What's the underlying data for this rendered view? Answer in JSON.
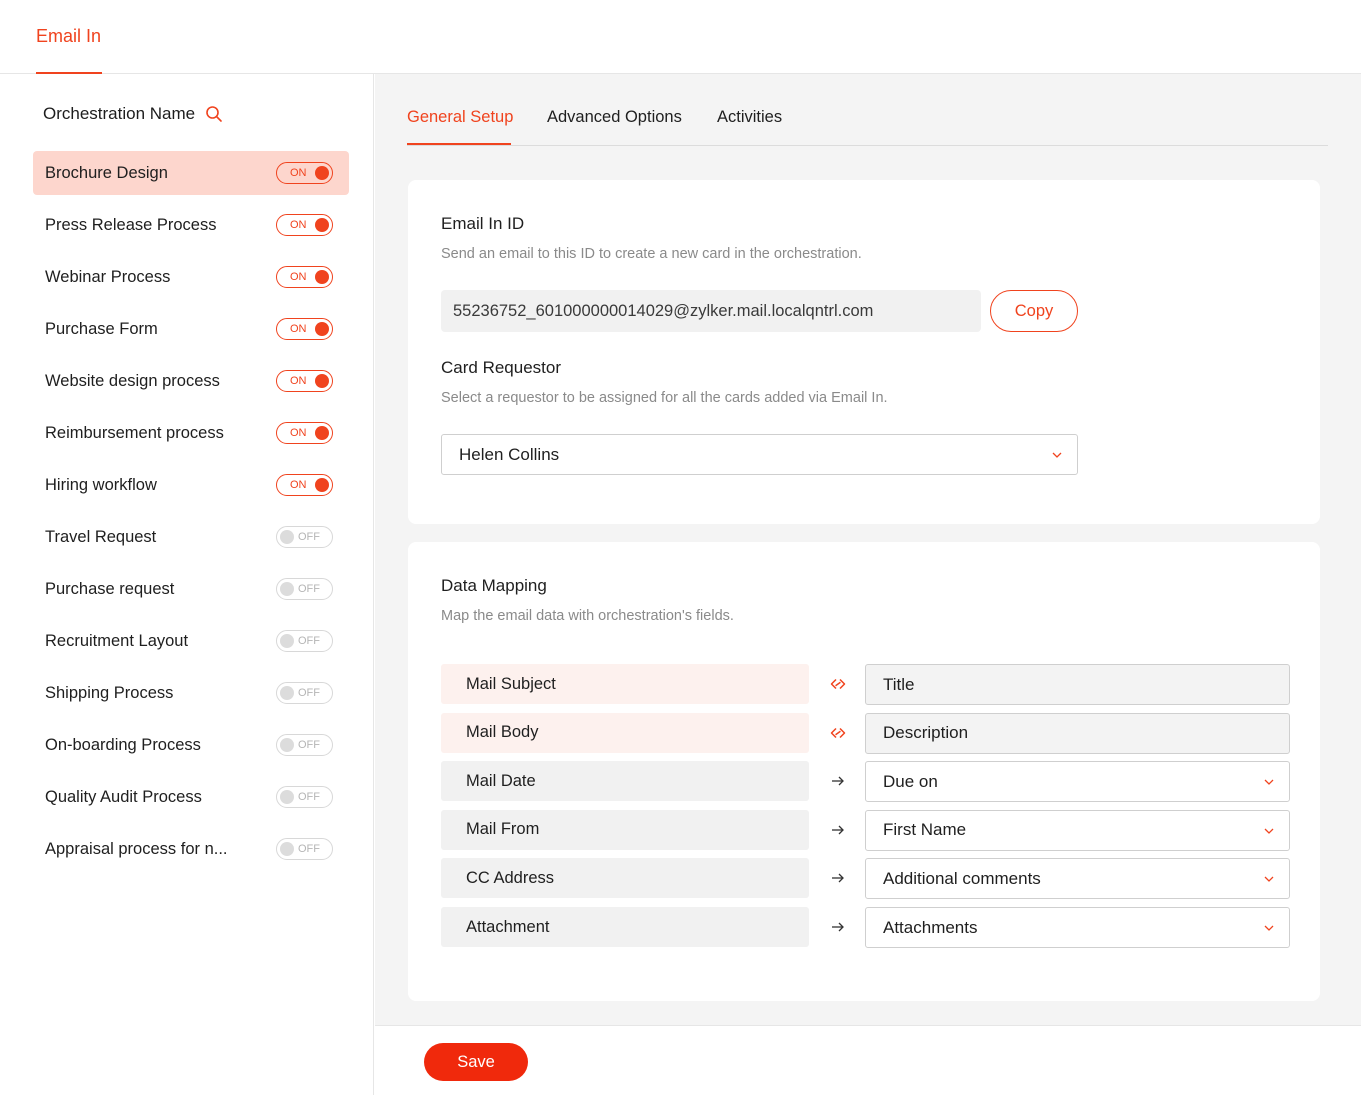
{
  "header": {
    "tab_label": "Email In"
  },
  "sidebar": {
    "heading": "Orchestration Name",
    "items": [
      {
        "label": "Brochure Design",
        "state": "ON",
        "active": true
      },
      {
        "label": "Press Release Process",
        "state": "ON"
      },
      {
        "label": "Webinar Process",
        "state": "ON"
      },
      {
        "label": "Purchase Form",
        "state": "ON"
      },
      {
        "label": "Website design process",
        "state": "ON"
      },
      {
        "label": "Reimbursement process",
        "state": "ON"
      },
      {
        "label": "Hiring workflow",
        "state": "ON"
      },
      {
        "label": "Travel Request",
        "state": "OFF"
      },
      {
        "label": "Purchase request",
        "state": "OFF"
      },
      {
        "label": "Recruitment Layout",
        "state": "OFF"
      },
      {
        "label": "Shipping Process",
        "state": "OFF"
      },
      {
        "label": "On-boarding Process",
        "state": "OFF"
      },
      {
        "label": "Quality Audit Process",
        "state": "OFF"
      },
      {
        "label": "Appraisal process for n...",
        "state": "OFF"
      }
    ]
  },
  "tabs": [
    {
      "label": "General Setup",
      "active": true
    },
    {
      "label": "Advanced Options"
    },
    {
      "label": "Activities"
    }
  ],
  "email_in": {
    "title": "Email In ID",
    "subtitle": "Send an email to this ID to create a new card in the orchestration.",
    "address": "55236752_601000000014029@zylker.mail.localqntrl.com",
    "copy_label": "Copy"
  },
  "requestor": {
    "title": "Card Requestor",
    "subtitle": "Select a requestor to be assigned for all the cards added via Email In.",
    "value": "Helen Collins"
  },
  "mapping": {
    "title": "Data Mapping",
    "subtitle": "Map the email data with orchestration's fields.",
    "rows": [
      {
        "source": "Mail Subject",
        "target": "Title",
        "linked": true
      },
      {
        "source": "Mail Body",
        "target": "Description",
        "linked": true
      },
      {
        "source": "Mail Date",
        "target": "Due on",
        "linked": false
      },
      {
        "source": "Mail From",
        "target": "First Name",
        "linked": false
      },
      {
        "source": "CC Address",
        "target": "Additional comments",
        "linked": false
      },
      {
        "source": "Attachment",
        "target": "Attachments",
        "linked": false
      }
    ]
  },
  "footer": {
    "save_label": "Save"
  },
  "colors": {
    "accent": "#f0431e",
    "active_bg": "#fdd6cd"
  }
}
